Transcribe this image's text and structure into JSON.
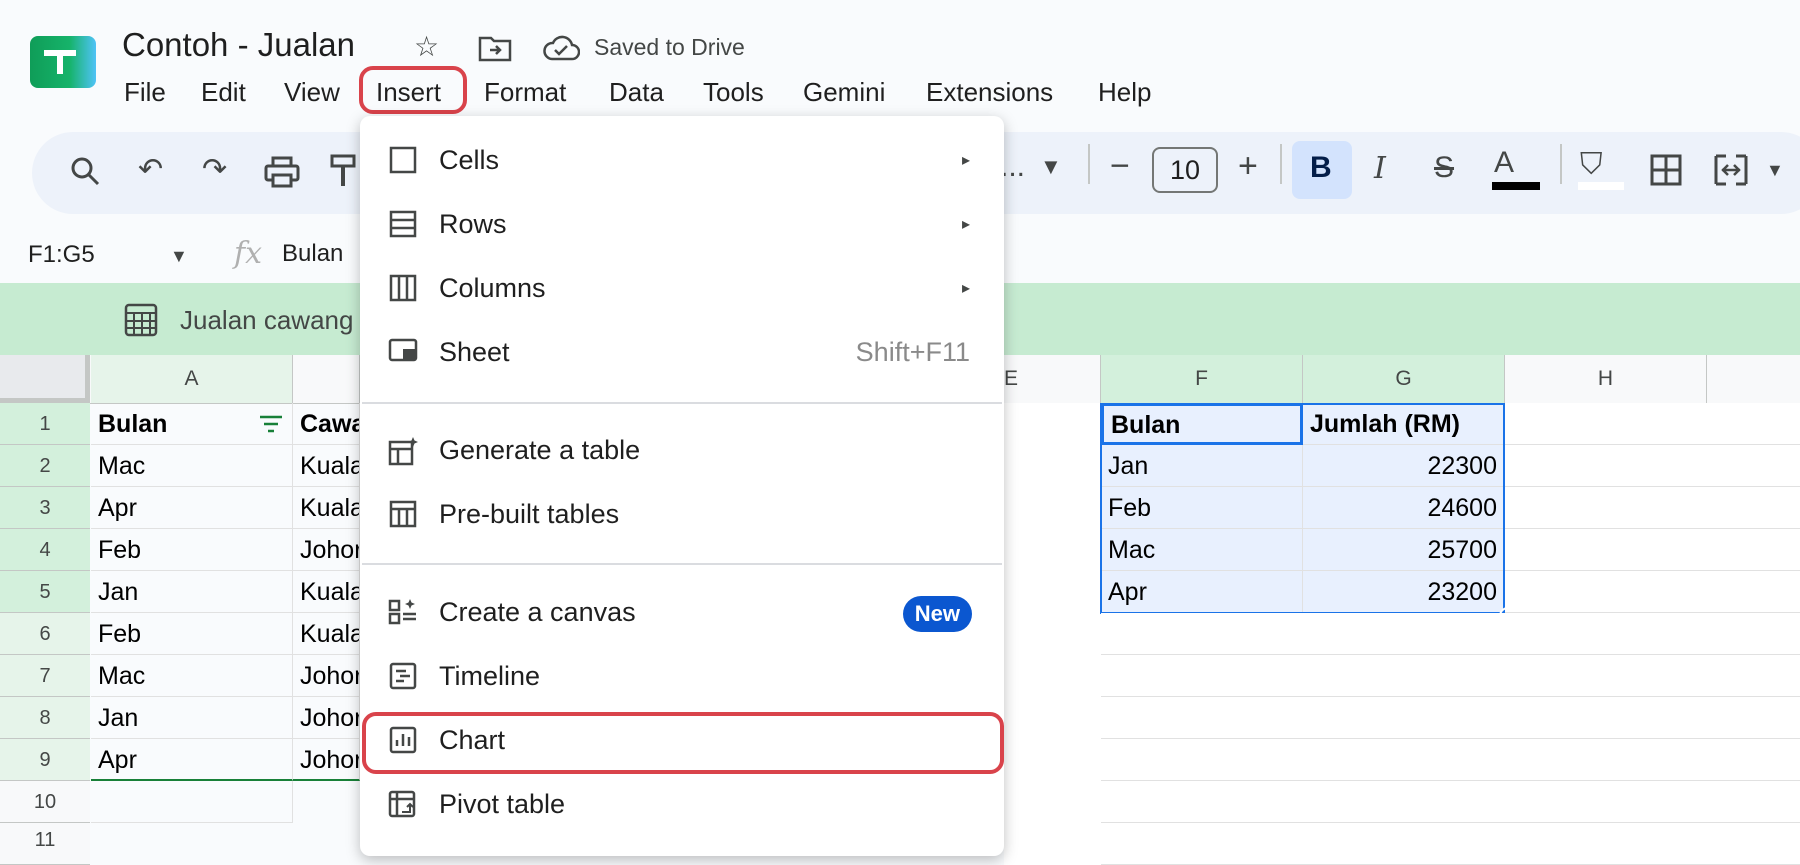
{
  "app": {
    "doc_title": "Contoh - Jualan",
    "save_status": "Saved to Drive"
  },
  "menubar": [
    "File",
    "Edit",
    "View",
    "Insert",
    "Format",
    "Data",
    "Tools",
    "Gemini",
    "Extensions",
    "Help"
  ],
  "toolbar": {
    "font_size": "10",
    "font_ellipsis": "..."
  },
  "formula_bar": {
    "name_box": "F1:G5",
    "fx_label": "fx",
    "content": "Bulan"
  },
  "banner": {
    "text": "Jualan cawang"
  },
  "grid": {
    "columns": [
      "A",
      "",
      "",
      "",
      "E",
      "F",
      "G",
      "H"
    ],
    "rows": [
      "1",
      "2",
      "3",
      "4",
      "5",
      "6",
      "7",
      "8",
      "9",
      "10",
      "11"
    ],
    "col_a": [
      "Bulan",
      "Mac",
      "Apr",
      "Feb",
      "Jan",
      "Feb",
      "Mac",
      "Jan",
      "Apr"
    ],
    "col_b": [
      "Cawa",
      "Kuala",
      "Kuala",
      "Johor",
      "Kuala",
      "Kuala",
      "Johor",
      "Johor",
      "Johor"
    ],
    "col_f": [
      "Bulan",
      "Jan",
      "Feb",
      "Mac",
      "Apr"
    ],
    "col_g": [
      "Jumlah (RM)",
      "22300",
      "24600",
      "25700",
      "23200"
    ]
  },
  "insert_menu": {
    "items": [
      {
        "label": "Cells",
        "icon": "cells-icon",
        "arrow": "▸"
      },
      {
        "label": "Rows",
        "icon": "rows-icon",
        "arrow": "▸"
      },
      {
        "label": "Columns",
        "icon": "columns-icon",
        "arrow": "▸"
      },
      {
        "label": "Sheet",
        "icon": "sheet-icon",
        "shortcut": "Shift+F11"
      },
      {
        "label": "Generate a table",
        "icon": "generate-table-icon"
      },
      {
        "label": "Pre-built tables",
        "icon": "prebuilt-tables-icon"
      },
      {
        "label": "Create a canvas",
        "icon": "canvas-icon",
        "badge": "New"
      },
      {
        "label": "Timeline",
        "icon": "timeline-icon"
      },
      {
        "label": "Chart",
        "icon": "chart-icon"
      },
      {
        "label": "Pivot table",
        "icon": "pivot-table-icon"
      }
    ]
  }
}
